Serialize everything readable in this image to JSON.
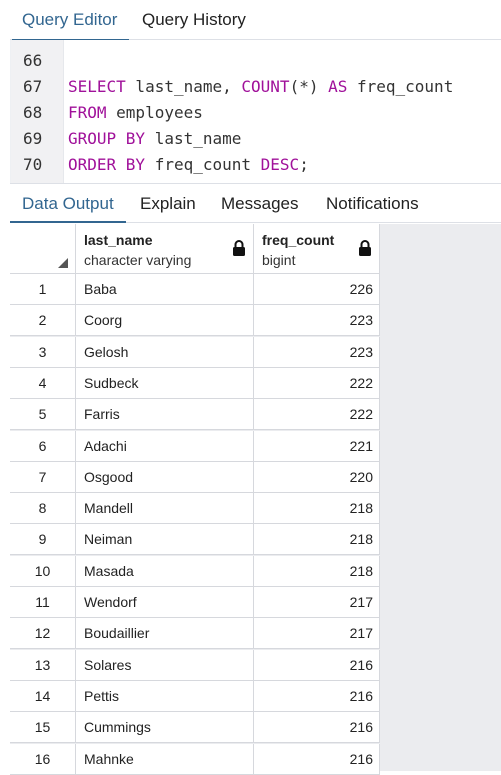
{
  "top_tabs": {
    "query_editor": "Query Editor",
    "query_history": "Query History"
  },
  "editor": {
    "line_numbers": [
      "66",
      "67",
      "68",
      "69",
      "70"
    ],
    "lines": [
      [],
      [
        {
          "t": "SELECT",
          "c": "kw"
        },
        {
          "t": " last_name, "
        },
        {
          "t": "COUNT",
          "c": "kw"
        },
        {
          "t": "(*) "
        },
        {
          "t": "AS",
          "c": "kw"
        },
        {
          "t": " freq_count"
        }
      ],
      [
        {
          "t": "FROM",
          "c": "kw"
        },
        {
          "t": " employees"
        }
      ],
      [
        {
          "t": "GROUP BY",
          "c": "kw"
        },
        {
          "t": " last_name"
        }
      ],
      [
        {
          "t": "ORDER BY",
          "c": "kw"
        },
        {
          "t": " freq_count "
        },
        {
          "t": "DESC",
          "c": "kw"
        },
        {
          "t": ";"
        }
      ]
    ]
  },
  "output_tabs": {
    "data_output": "Data Output",
    "explain": "Explain",
    "messages": "Messages",
    "notifications": "Notifications"
  },
  "grid": {
    "columns": [
      {
        "name": "last_name",
        "type": "character varying"
      },
      {
        "name": "freq_count",
        "type": "bigint"
      }
    ],
    "rows": [
      [
        "1",
        "Baba",
        "226"
      ],
      [
        "2",
        "Coorg",
        "223"
      ],
      [
        "3",
        "Gelosh",
        "223"
      ],
      [
        "4",
        "Sudbeck",
        "222"
      ],
      [
        "5",
        "Farris",
        "222"
      ],
      [
        "6",
        "Adachi",
        "221"
      ],
      [
        "7",
        "Osgood",
        "220"
      ],
      [
        "8",
        "Mandell",
        "218"
      ],
      [
        "9",
        "Neiman",
        "218"
      ],
      [
        "10",
        "Masada",
        "218"
      ],
      [
        "11",
        "Wendorf",
        "217"
      ],
      [
        "12",
        "Boudaillier",
        "217"
      ],
      [
        "13",
        "Solares",
        "216"
      ],
      [
        "14",
        "Pettis",
        "216"
      ],
      [
        "15",
        "Cummings",
        "216"
      ],
      [
        "16",
        "Mahnke",
        "216"
      ]
    ]
  },
  "colors": {
    "accent": "#326690",
    "keyword": "#a0119a",
    "grid_bg": "#ebecef"
  }
}
